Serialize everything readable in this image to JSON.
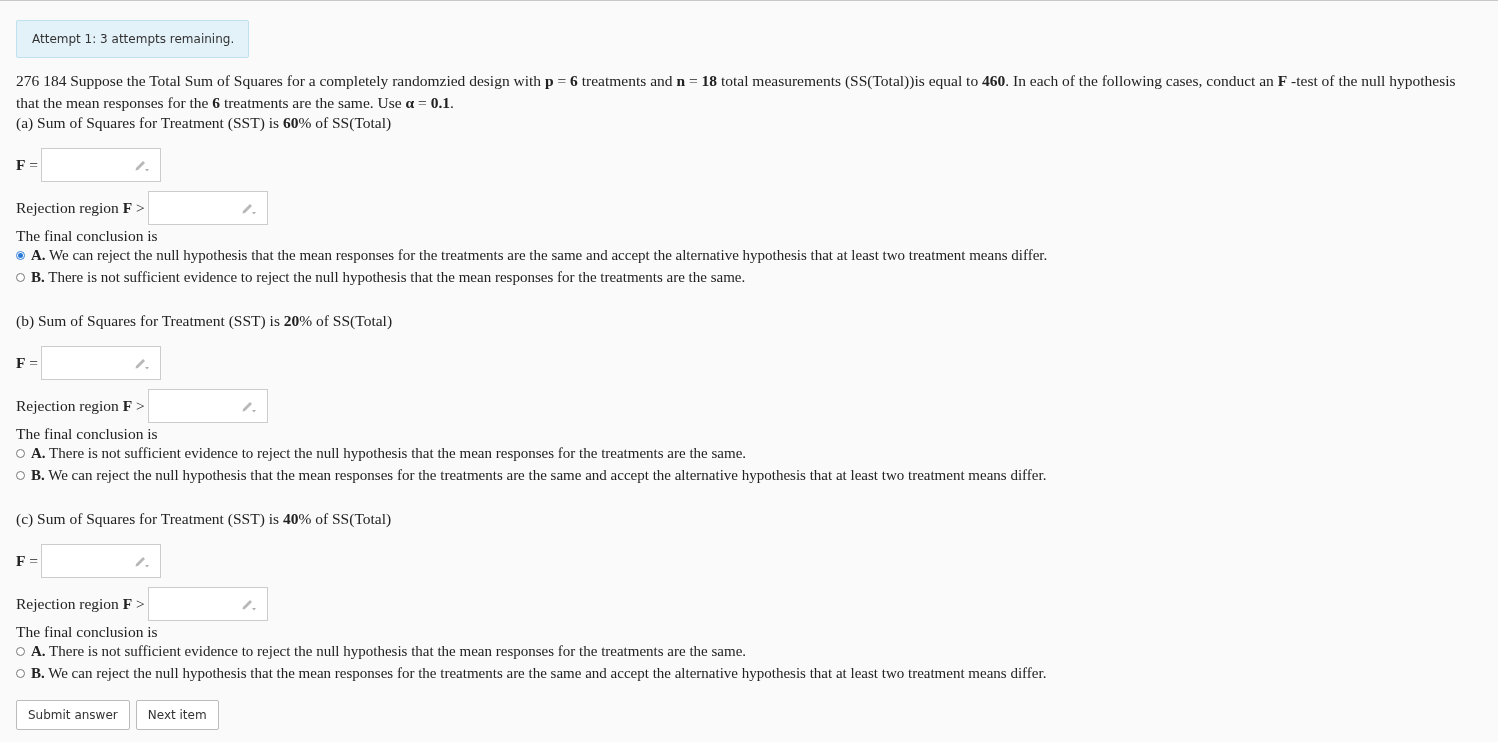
{
  "attempt_notice": "Attempt 1: 3 attempts remaining.",
  "intro": "276 184 Suppose the Total Sum of Squares for a completely randomzied design with **p** = **6** treatments and **n** = **18** total measurements (SS(Total))is equal to **460**. In each of the following cases, conduct an **F** -test of the null hypothesis that the mean responses for the **6** treatments are the same. Use **α** = **0.1**.",
  "parts": [
    {
      "heading": "(a) Sum of Squares for Treatment (SST) is **60**% of SS(Total)",
      "f_label": "**F** =",
      "rejection_label": "Rejection region **F** >",
      "conclusion_label": "The final conclusion is",
      "options": [
        {
          "letter": "A.",
          "text": "We can reject the null hypothesis that the mean responses for the treatments are the same and accept the alternative hypothesis that at least two treatment means differ.",
          "selected": true
        },
        {
          "letter": "B.",
          "text": "There is not sufficient evidence to reject the null hypothesis that the mean responses for the treatments are the same.",
          "selected": false
        }
      ]
    },
    {
      "heading": "(b) Sum of Squares for Treatment (SST) is **20**% of SS(Total)",
      "f_label": "**F** =",
      "rejection_label": "Rejection region **F** >",
      "conclusion_label": "The final conclusion is",
      "options": [
        {
          "letter": "A.",
          "text": "There is not sufficient evidence to reject the null hypothesis that the mean responses for the treatments are the same.",
          "selected": false
        },
        {
          "letter": "B.",
          "text": "We can reject the null hypothesis that the mean responses for the treatments are the same and accept the alternative hypothesis that at least two treatment means differ.",
          "selected": false
        }
      ]
    },
    {
      "heading": "(c) Sum of Squares for Treatment (SST) is **40**% of SS(Total)",
      "f_label": "**F** =",
      "rejection_label": "Rejection region **F** >",
      "conclusion_label": "The final conclusion is",
      "options": [
        {
          "letter": "A.",
          "text": "There is not sufficient evidence to reject the null hypothesis that the mean responses for the treatments are the same.",
          "selected": false
        },
        {
          "letter": "B.",
          "text": "We can reject the null hypothesis that the mean responses for the treatments are the same and accept the alternative hypothesis that at least two treatment means differ.",
          "selected": false
        }
      ]
    }
  ],
  "buttons": [
    "Submit answer",
    "Next item"
  ]
}
